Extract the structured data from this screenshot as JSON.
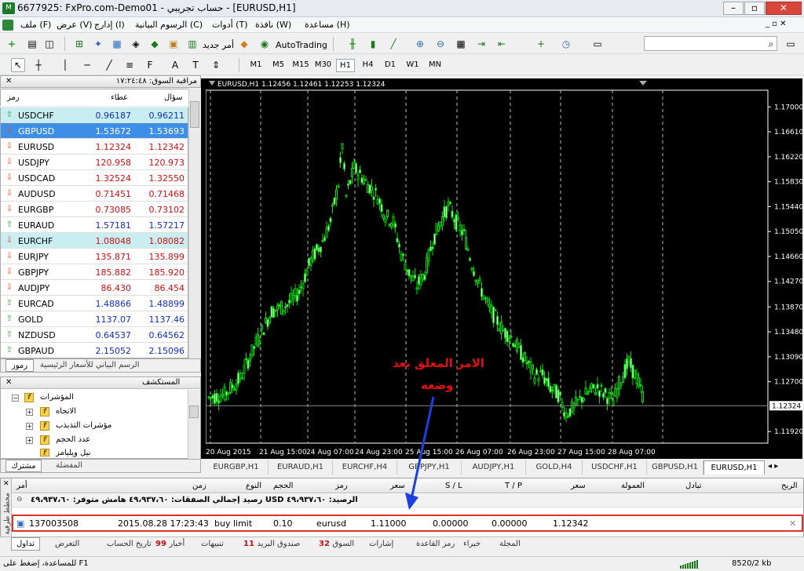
{
  "window": {
    "title": "6677925: FxPro.com-Demo01 - حساب تجريبي - [EURUSD,H1]"
  },
  "menu": [
    "مساعدة (H)",
    "نافذة (W)",
    "أدوات (T)",
    "الرسوم البيانية (C)",
    "إدارج (I)",
    "عرض (V)",
    "ملف (F)"
  ],
  "toolbar": {
    "new_order": "أمر جديد",
    "autotrading": "AutoTrading",
    "timeframes": [
      "M1",
      "M5",
      "M15",
      "M30",
      "H1",
      "H4",
      "D1",
      "W1",
      "MN"
    ],
    "selected_timeframe": "H1"
  },
  "market_watch": {
    "title": "مراقبة السوق: ١٧:٢٤:٤٨",
    "col_symbol": "رمز",
    "col_bid": "عطاء",
    "col_ask": "سؤال",
    "rows": [
      {
        "symbol": "USDCHF",
        "bid": "0.96187",
        "ask": "0.96211",
        "dir": "up",
        "color": "#1030c0",
        "bg": "#c9eef2"
      },
      {
        "symbol": "GBPUSD",
        "bid": "1.53672",
        "ask": "1.53693",
        "dir": "down",
        "color": "#ffffff",
        "bg": "#3d8ee6"
      },
      {
        "symbol": "EURUSD",
        "bid": "1.12324",
        "ask": "1.12342",
        "dir": "down",
        "color": "#d01010",
        "bg": "#ffffff"
      },
      {
        "symbol": "USDJPY",
        "bid": "120.958",
        "ask": "120.973",
        "dir": "down",
        "color": "#d01010",
        "bg": "#ffffff"
      },
      {
        "symbol": "USDCAD",
        "bid": "1.32524",
        "ask": "1.32550",
        "dir": "down",
        "color": "#d01010",
        "bg": "#ffffff"
      },
      {
        "symbol": "AUDUSD",
        "bid": "0.71451",
        "ask": "0.71468",
        "dir": "down",
        "color": "#d01010",
        "bg": "#ffffff"
      },
      {
        "symbol": "EURGBP",
        "bid": "0.73085",
        "ask": "0.73102",
        "dir": "down",
        "color": "#d01010",
        "bg": "#ffffff"
      },
      {
        "symbol": "EURAUD",
        "bid": "1.57181",
        "ask": "1.57217",
        "dir": "up",
        "color": "#1030c0",
        "bg": "#ffffff"
      },
      {
        "symbol": "EURCHF",
        "bid": "1.08048",
        "ask": "1.08082",
        "dir": "down",
        "color": "#d01010",
        "bg": "#c9eef2"
      },
      {
        "symbol": "EURJPY",
        "bid": "135.871",
        "ask": "135.899",
        "dir": "down",
        "color": "#d01010",
        "bg": "#ffffff"
      },
      {
        "symbol": "GBPJPY",
        "bid": "185.882",
        "ask": "185.920",
        "dir": "down",
        "color": "#d01010",
        "bg": "#ffffff"
      },
      {
        "symbol": "AUDJPY",
        "bid": "86.430",
        "ask": "86.454",
        "dir": "down",
        "color": "#d01010",
        "bg": "#ffffff"
      },
      {
        "symbol": "EURCAD",
        "bid": "1.48866",
        "ask": "1.48899",
        "dir": "up",
        "color": "#1030c0",
        "bg": "#ffffff"
      },
      {
        "symbol": "GOLD",
        "bid": "1137.07",
        "ask": "1137.46",
        "dir": "up",
        "color": "#1030c0",
        "bg": "#ffffff"
      },
      {
        "symbol": "NZDUSD",
        "bid": "0.64537",
        "ask": "0.64562",
        "dir": "up",
        "color": "#1030c0",
        "bg": "#ffffff"
      },
      {
        "symbol": "GBPAUD",
        "bid": "2.15052",
        "ask": "2.15096",
        "dir": "up",
        "color": "#1030c0",
        "bg": "#ffffff"
      }
    ],
    "tabs": [
      "رموز",
      "الرسم البياني للأسعار الرئيسية"
    ]
  },
  "navigator": {
    "title": "المستكشف",
    "items": [
      "المؤشرات",
      "الاتجاه",
      "مؤشرات التذبذب",
      "عدد الحجم",
      "بيل ويليامز"
    ],
    "tabs": [
      "مشترك",
      "المفضلة"
    ]
  },
  "chart": {
    "header": "EURUSD,H1  1.12456 1.12461 1.12253 1.12324",
    "price_labels": [
      "1.17000",
      "1.16610",
      "1.16220",
      "1.15830",
      "1.15440",
      "1.15050",
      "1.14660",
      "1.14270",
      "1.13870",
      "1.13480",
      "1.13090",
      "1.12700",
      "1.11920"
    ],
    "current_price": "1.12324",
    "time_labels": [
      "20 Aug 2015",
      "21 Aug 15:00",
      "24 Aug 07:00",
      "24 Aug 23:00",
      "25 Aug 15:00",
      "26 Aug 07:00",
      "26 Aug 23:00",
      "27 Aug 15:00",
      "28 Aug 07:00"
    ],
    "annotation_line1": "الامر المعلق بعد",
    "annotation_line2": "وضعه",
    "bull_color": "#00e000",
    "bg_color": "#000000",
    "annotation_color": "#e01010",
    "arrow_color": "#1a40e0"
  },
  "chart_tabs": [
    "EURGBP,H1",
    "EURAUD,H1",
    "EURCHF,H4",
    "GBPJPY,H1",
    "AUDJPY,H1",
    "GOLD,H4",
    "USDCHF,H1",
    "GBPUSD,H1",
    "EURUSD,H1"
  ],
  "chart_tab_selected": "EURUSD,H1",
  "terminal": {
    "headers": {
      "order": "أمر",
      "time": "زمن",
      "type": "النوع",
      "volume": "الحجم",
      "symbol": "رمز",
      "price": "سعر",
      "sl": "S / L",
      "tp": "T / P",
      "price2": "سعر",
      "commission": "العمولة",
      "swap": "تبادل",
      "profit": "الربح"
    },
    "balance": "رصيد إجمالي الصفقات: ٤٩،٩٣٧،٦٠  هامش متوفر: ٤٩،٩٣٧،٦٠ USD  الرصيد: ٤٩،٩٣٧،٦٠",
    "order": {
      "ticket": "137003508",
      "time": "2015.08.28 17:23:43",
      "type": "buy limit",
      "volume": "0.10",
      "symbol": "eurusd",
      "price": "1.11000",
      "sl": "0.00000",
      "tp": "0.00000",
      "cur_price": "1.12342"
    },
    "tabs": [
      {
        "label": "تداول",
        "badge": ""
      },
      {
        "label": "التعرض",
        "badge": ""
      },
      {
        "label": "تاريخ الحساب",
        "badge": ""
      },
      {
        "label": "أخبار",
        "badge": "99"
      },
      {
        "label": "تنبيهات",
        "badge": ""
      },
      {
        "label": "صندوق البريد",
        "badge": "11"
      },
      {
        "label": "السوق",
        "badge": "32"
      },
      {
        "label": "إشارات",
        "badge": ""
      },
      {
        "label": "رمز القاعدة",
        "badge": ""
      },
      {
        "label": "خبراء",
        "badge": ""
      },
      {
        "label": "المجلة",
        "badge": ""
      }
    ],
    "side_label": "مخطط طرفية"
  },
  "status": {
    "help": "للمساعدة، إضغط على F1",
    "traffic": "8520/2 kb"
  }
}
